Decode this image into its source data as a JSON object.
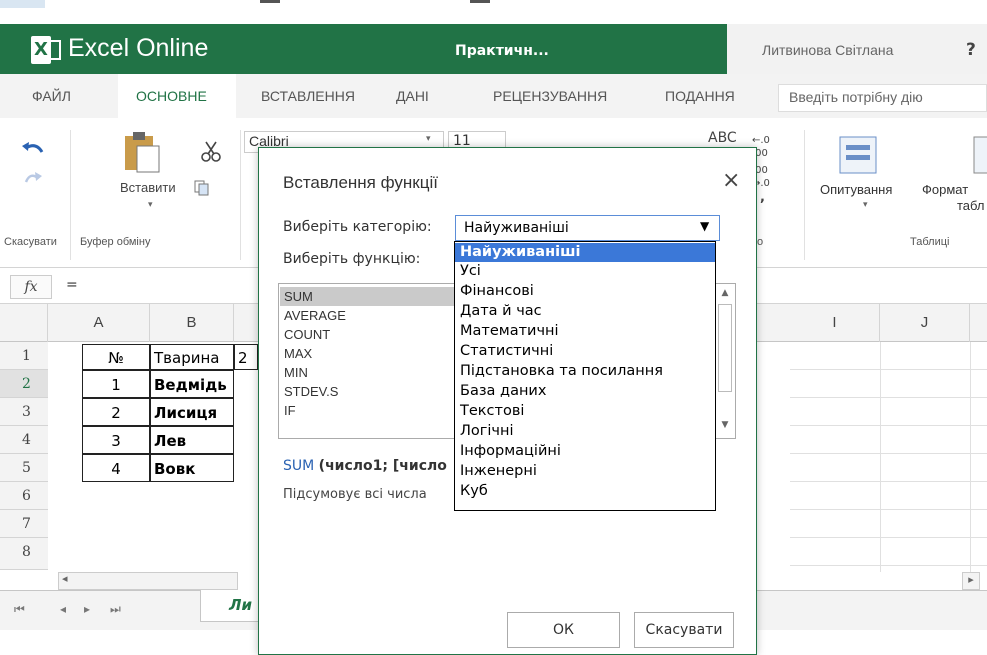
{
  "app": {
    "name": "Excel Online",
    "document_title": "Практичн...",
    "user": "Литвинова Світлана",
    "help": "?"
  },
  "tabs": [
    {
      "label": "ФАЙЛ"
    },
    {
      "label": "ОСНОВНЕ",
      "active": true
    },
    {
      "label": "ВСТАВЛЕННЯ"
    },
    {
      "label": "ДАНІ"
    },
    {
      "label": "РЕЦЕНЗУВАННЯ"
    },
    {
      "label": "ПОДАННЯ"
    }
  ],
  "tell_me_placeholder": "Введіть потрібну дію",
  "ribbon": {
    "undo_group": "Скасувати",
    "paste_label": "Вставити",
    "clipboard_group": "Буфер обміну",
    "font_name": "Calibri",
    "font_size": "11",
    "abc": "ABC",
    "survey_label": "Опитування",
    "format_label": "Формат",
    "format_label2": "табл",
    "tables_group": "Таблиці",
    "small_o": "о"
  },
  "formula_bar": {
    "fx": "fx",
    "content": "="
  },
  "grid": {
    "columns": [
      "A",
      "B",
      "I",
      "J"
    ],
    "rows": [
      "1",
      "2",
      "3",
      "4",
      "5",
      "6",
      "7",
      "8"
    ],
    "table": [
      [
        "№",
        "Тварина",
        "2"
      ],
      [
        "1",
        "Ведмідь",
        ""
      ],
      [
        "2",
        "Лисиця",
        ""
      ],
      [
        "3",
        "Лев",
        ""
      ],
      [
        "4",
        "Вовк",
        ""
      ]
    ]
  },
  "sheet_tab": "Ли",
  "dialog": {
    "title": "Вставлення функції",
    "close": "×",
    "category_label": "Виберіть категорію:",
    "category_value": "Найуживаніші",
    "function_label": "Виберіть функцію:",
    "functions": [
      "SUM",
      "AVERAGE",
      "COUNT",
      "MAX",
      "MIN",
      "STDEV.S",
      "IF"
    ],
    "signature_name": "SUM",
    "signature_args": "(число1; [число",
    "description": "Підсумовує всі числа",
    "ok": "ОК",
    "cancel": "Скасувати",
    "categories": [
      "Найуживаніші",
      "Усі",
      "Фінансові",
      "Дата й час",
      "Математичні",
      "Статистичні",
      "Підстановка та посилання",
      "База даних",
      "Текстові",
      "Логічні",
      "Інформаційні",
      "Інженерні",
      "Куб"
    ]
  }
}
